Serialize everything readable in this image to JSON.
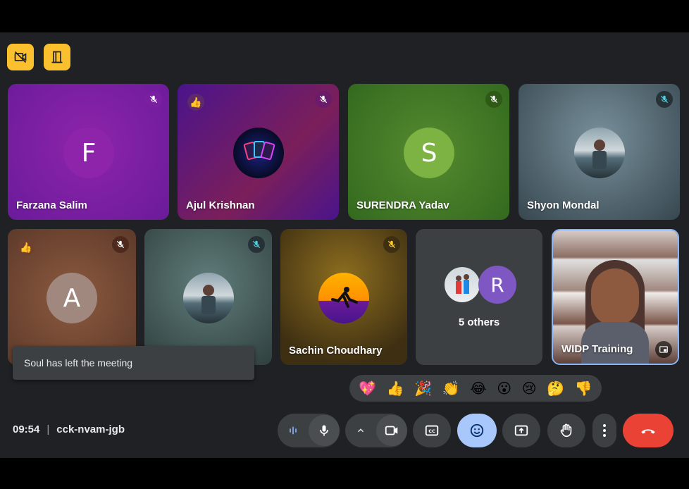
{
  "colors": {
    "accent_yellow": "#fbc02d",
    "end_call": "#ea4335",
    "emoji_active": "#a8c7fa",
    "background": "#202124",
    "control": "#3c4043"
  },
  "top_buttons": [
    {
      "icon": "video-off-icon"
    },
    {
      "icon": "exit-door-icon"
    }
  ],
  "tiles": [
    {
      "name": "Farzana Salim",
      "avatar_letter": "F",
      "muted": true
    },
    {
      "name": "Ajul Krishnan",
      "avatar_letter": "",
      "muted": true,
      "reaction": "👍"
    },
    {
      "name": "SURENDRA Yadav",
      "avatar_letter": "S",
      "muted": true
    },
    {
      "name": "Shyon Mondal",
      "avatar_letter": "",
      "muted": true
    },
    {
      "name": "",
      "avatar_letter": "A",
      "muted": true,
      "reaction": "👍"
    },
    {
      "name": "",
      "avatar_letter": "",
      "muted": true
    },
    {
      "name": "Sachin Choudhary",
      "avatar_letter": "",
      "muted": true
    },
    {
      "name": "5 others",
      "avatar_letter": "R"
    },
    {
      "name": "WIDP Training"
    }
  ],
  "toast": {
    "text": "Soul has left the meeting"
  },
  "reactions": [
    "💖",
    "👍",
    "🎉",
    "👏",
    "😂",
    "😮",
    "😢",
    "🤔",
    "👎"
  ],
  "meeting": {
    "time": "09:54",
    "separator": "|",
    "code": "cck-nvam-jgb"
  },
  "controls": [
    {
      "icon": "audio-levels-icon"
    },
    {
      "icon": "microphone-icon"
    },
    {
      "icon": "chevron-up-icon"
    },
    {
      "icon": "camera-icon"
    },
    {
      "icon": "captions-icon"
    },
    {
      "icon": "emoji-icon"
    },
    {
      "icon": "present-screen-icon"
    },
    {
      "icon": "raise-hand-icon"
    },
    {
      "icon": "more-options-icon"
    },
    {
      "icon": "end-call-icon"
    }
  ]
}
